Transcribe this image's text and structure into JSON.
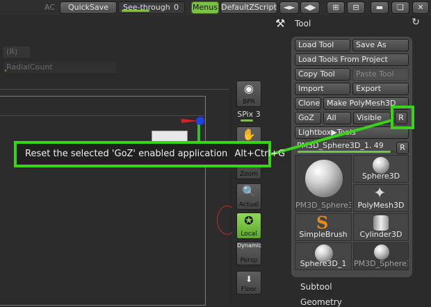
{
  "topbar": {
    "ac": "AC",
    "quicksave": "QuickSave",
    "seethrough_label": "See-through",
    "seethrough_value": "0",
    "menus": "Menus",
    "default_zscript": "DefaultZScript"
  },
  "left": {
    "r_field": "(R)",
    "radial_count": "RadialCount"
  },
  "shelf": {
    "bpr": "BPR",
    "spix": "SPix 3",
    "zoom": "Zoom",
    "actual": "Actual",
    "local": "Local",
    "persp": "Persp",
    "dynamic": "Dynamic",
    "floor": "Floor"
  },
  "tool": {
    "title": "Tool",
    "buttons": {
      "load_tool": "Load Tool",
      "save_as": "Save As",
      "load_from_project": "Load Tools From Project",
      "copy_tool": "Copy Tool",
      "paste_tool": "Paste Tool",
      "import": "Import",
      "export": "Export",
      "clone": "Clone",
      "make_polymesh": "Make PolyMesh3D",
      "goz": "GoZ",
      "all": "All",
      "visible": "Visible",
      "r": "R",
      "lightbox": "Lightbox▶Tools",
      "r2": "R"
    },
    "current": "PM3D_Sphere3D_1. 49",
    "thumbnails": [
      "PM3D_Sphere3",
      "Sphere3D",
      "PolyMesh3D",
      "SimpleBrush",
      "Cylinder3D",
      "Sphere3D_1",
      "PM3D_Sphere3"
    ],
    "subtool": "Subtool",
    "geometry": "Geometry"
  },
  "tooltip": {
    "text": "Reset the selected 'GoZ' enabled application",
    "shortcut": "Alt+Ctrl+G"
  },
  "colors": {
    "accent_green": "#7cc242",
    "highlight_green": "#3ad21a",
    "panel": "#494949",
    "background": "#2a2a2a"
  }
}
